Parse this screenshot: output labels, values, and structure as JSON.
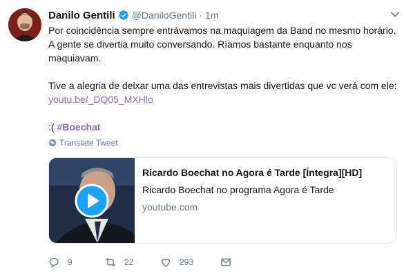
{
  "tweet": {
    "author_name": "Danilo Gentili",
    "author_handle": "@DaniloGentili",
    "separator": "·",
    "time": "1m",
    "paragraph1": "Por coincidência sempre entrávamos na maquiagem da Band no mesmo horário. A gente se divertia muito conversando. Ríamos bastante enquanto nos maquiavam.",
    "paragraph2": "Tive a alegria de deixar uma das entrevistas mais divertidas que vc verá com ele:",
    "link": "youtu.be/_DQ05_MXHlo",
    "sad_face": ":(",
    "hashtag": "#Boechat",
    "translate_label": "Translate Tweet"
  },
  "card": {
    "title": "Ricardo Boechat no Agora é Tarde [Íntegra][HD]",
    "description": "Ricardo Boechat no programa Agora é Tarde",
    "domain": "youtube.com"
  },
  "actions": {
    "replies": "9",
    "retweets": "22",
    "likes": "293"
  },
  "colors": {
    "link": "#8c6ac4",
    "verified": "#1da1f2",
    "muted": "#657786",
    "play_button": "#1da1f2"
  }
}
